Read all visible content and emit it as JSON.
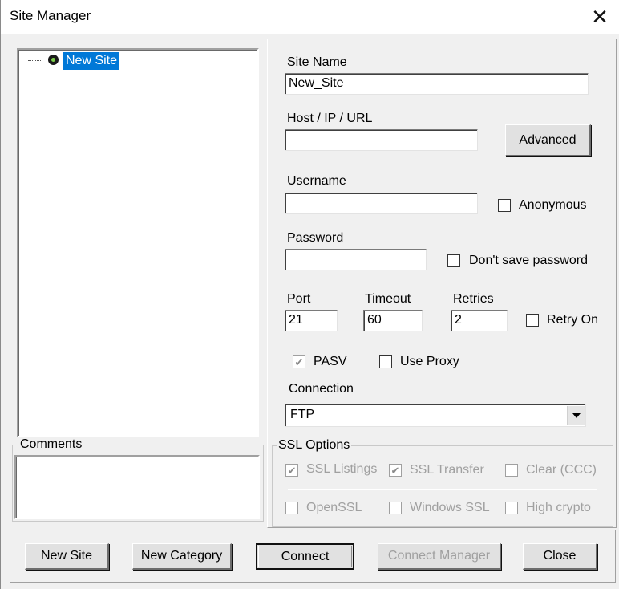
{
  "window": {
    "title": "Site Manager",
    "close_icon": "close-icon"
  },
  "tree": {
    "items": [
      {
        "label": "New Site",
        "selected": true,
        "icon": "site-node-icon"
      }
    ]
  },
  "comments": {
    "label": "Comments",
    "value": ""
  },
  "form": {
    "site_name": {
      "label": "Site Name",
      "value": "New_Site"
    },
    "host": {
      "label": "Host / IP / URL",
      "value": ""
    },
    "advanced_button": "Advanced",
    "username": {
      "label": "Username",
      "value": ""
    },
    "anonymous": {
      "label": "Anonymous",
      "checked": false
    },
    "password": {
      "label": "Password",
      "value": ""
    },
    "dont_save_password": {
      "label": "Don't save password",
      "checked": false
    },
    "port": {
      "label": "Port",
      "value": "21"
    },
    "timeout": {
      "label": "Timeout",
      "value": "60"
    },
    "retries": {
      "label": "Retries",
      "value": "2"
    },
    "retry_on": {
      "label": "Retry On",
      "checked": false
    },
    "pasv": {
      "label": "PASV",
      "checked": true,
      "disabled": true
    },
    "use_proxy": {
      "label": "Use Proxy",
      "checked": false
    },
    "connection": {
      "label": "Connection",
      "value": "FTP"
    }
  },
  "ssl": {
    "title": "SSL Options",
    "ssl_listings": {
      "label": "SSL Listings",
      "checked": true,
      "disabled": true
    },
    "ssl_transfer": {
      "label": "SSL Transfer",
      "checked": true,
      "disabled": true
    },
    "clear_ccc": {
      "label": "Clear (CCC)",
      "checked": false,
      "disabled": true
    },
    "openssl": {
      "label": "OpenSSL",
      "checked": false,
      "disabled": true
    },
    "windows_ssl": {
      "label": "Windows SSL",
      "checked": false,
      "disabled": true
    },
    "high_crypto": {
      "label": "High crypto",
      "checked": false,
      "disabled": true
    }
  },
  "buttons": {
    "new_site": "New Site",
    "new_category": "New Category",
    "connect": "Connect",
    "connect_manager": "Connect Manager",
    "close": "Close"
  },
  "check_mark": "✔"
}
